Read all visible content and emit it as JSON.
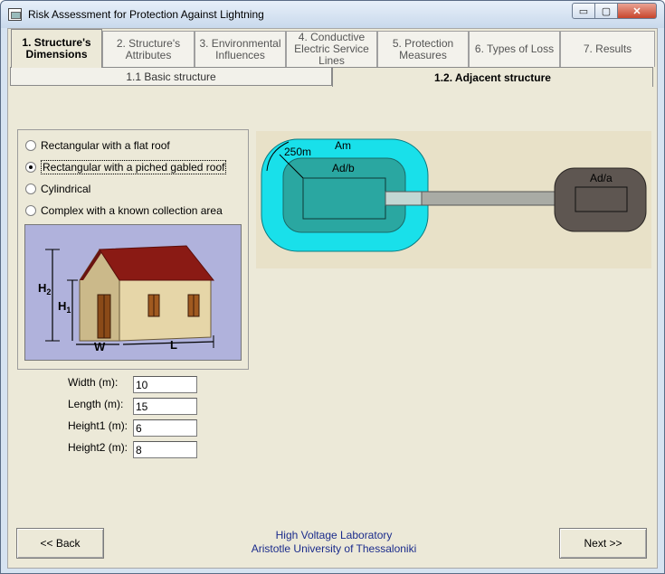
{
  "window": {
    "title": "Risk Assessment for Protection Against Lightning",
    "controls": {
      "minimize": "▭",
      "maximize": "▢",
      "close": "✕"
    }
  },
  "main_tabs": [
    {
      "line1": "1. Structure's",
      "line2": "Dimensions",
      "line3": "",
      "active": true
    },
    {
      "line1": "2. Structure's",
      "line2": "Attributes",
      "line3": "",
      "active": false
    },
    {
      "line1": "3. Environmental",
      "line2": "Influences",
      "line3": "",
      "active": false
    },
    {
      "line1": "4. Conductive",
      "line2": "Electric Service",
      "line3": "Lines",
      "active": false
    },
    {
      "line1": "5. Protection",
      "line2": "Measures",
      "line3": "",
      "active": false
    },
    {
      "line1": "6. Types of Loss",
      "line2": "",
      "line3": "",
      "active": false
    },
    {
      "line1": "7. Results",
      "line2": "",
      "line3": "",
      "active": false
    }
  ],
  "sub_tabs": [
    {
      "label": "1.1  Basic structure",
      "active": false
    },
    {
      "label": "1.2. Adjacent structure",
      "active": true
    }
  ],
  "structure_types": [
    {
      "label": "Rectangular with a flat roof",
      "checked": false
    },
    {
      "label": "Rectangular with a piched gabled roof",
      "checked": true
    },
    {
      "label": "Cylindrical",
      "checked": false
    },
    {
      "label": "Complex with a known collection area",
      "checked": false
    }
  ],
  "house_illustration": {
    "labels": {
      "h2": "H",
      "h2_sub": "2",
      "h1": "H",
      "h1_sub": "1",
      "w": "W",
      "l": "L"
    }
  },
  "fields": [
    {
      "label": "Width (m):",
      "value": "10"
    },
    {
      "label": "Length (m):",
      "value": "15"
    },
    {
      "label": "Height1 (m):",
      "value": "6"
    },
    {
      "label": "Height2 (m):",
      "value": "8"
    }
  ],
  "diagram": {
    "distance_label": "250m",
    "am_label": "Am",
    "adb_label": "Ad/b",
    "ada_label": "Ad/a",
    "colors": {
      "background": "#e8e1c8",
      "am_zone": "#19e0ea",
      "adb_zone": "#2aa7a1",
      "ada_zone": "#5e5651"
    }
  },
  "footer": {
    "line1": "High Voltage Laboratory",
    "line2": "Aristotle University of Thessaloniki"
  },
  "buttons": {
    "back": "<< Back",
    "next": "Next >>"
  }
}
